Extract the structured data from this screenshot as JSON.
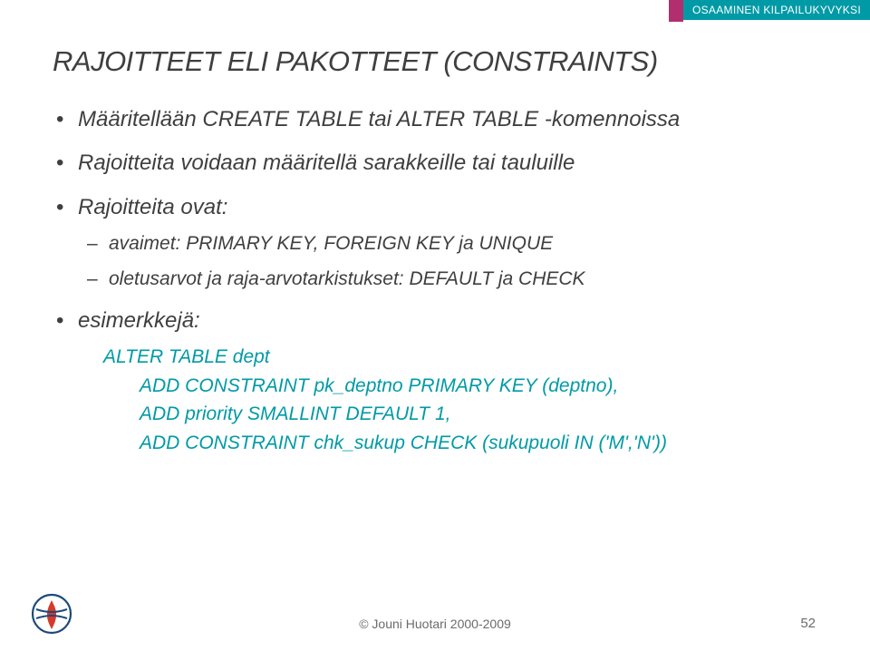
{
  "topbar": {
    "tag": "OSAAMINEN KILPAILUKYVYKSI"
  },
  "title": "RAJOITTEET ELI PAKOTTEET (CONSTRAINTS)",
  "bullets": {
    "b1": "Määritellään CREATE TABLE tai ALTER TABLE -komennoissa",
    "b2": "Rajoitteita voidaan määritellä sarakkeille tai tauluille",
    "b3": "Rajoitteita ovat:",
    "b3a": "avaimet: PRIMARY KEY, FOREIGN KEY ja UNIQUE",
    "b3b": "oletusarvot ja raja-arvotarkistukset: DEFAULT ja CHECK",
    "b4": "esimerkkejä:"
  },
  "code": {
    "l1": "ALTER TABLE dept",
    "l2": "ADD CONSTRAINT pk_deptno PRIMARY KEY (deptno),",
    "l3": "ADD priority SMALLINT DEFAULT 1,",
    "l4": "ADD CONSTRAINT chk_sukup CHECK (sukupuoli IN ('M','N'))"
  },
  "footer": {
    "copyright": "© Jouni Huotari 2000-2009",
    "page": "52"
  }
}
